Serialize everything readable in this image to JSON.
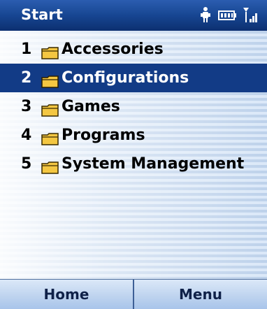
{
  "window": {
    "title": "Start"
  },
  "status_bar": {
    "icons": [
      "connectivity-icon",
      "battery-icon",
      "signal-icon"
    ]
  },
  "menu": {
    "selected_index": 1,
    "items": [
      {
        "num": "1",
        "label": "Accessories",
        "icon": "folder-icon"
      },
      {
        "num": "2",
        "label": "Configurations",
        "icon": "folder-icon"
      },
      {
        "num": "3",
        "label": "Games",
        "icon": "folder-icon"
      },
      {
        "num": "4",
        "label": "Programs",
        "icon": "folder-icon"
      },
      {
        "num": "5",
        "label": "System Management",
        "icon": "folder-icon"
      }
    ]
  },
  "softkeys": {
    "left": "Home",
    "right": "Menu"
  },
  "colors": {
    "titlebar": "#174692",
    "selection": "#123b86",
    "softkey_text": "#0f2148",
    "folder_fill": "#f4c742",
    "folder_outline": "#3a2b00"
  }
}
